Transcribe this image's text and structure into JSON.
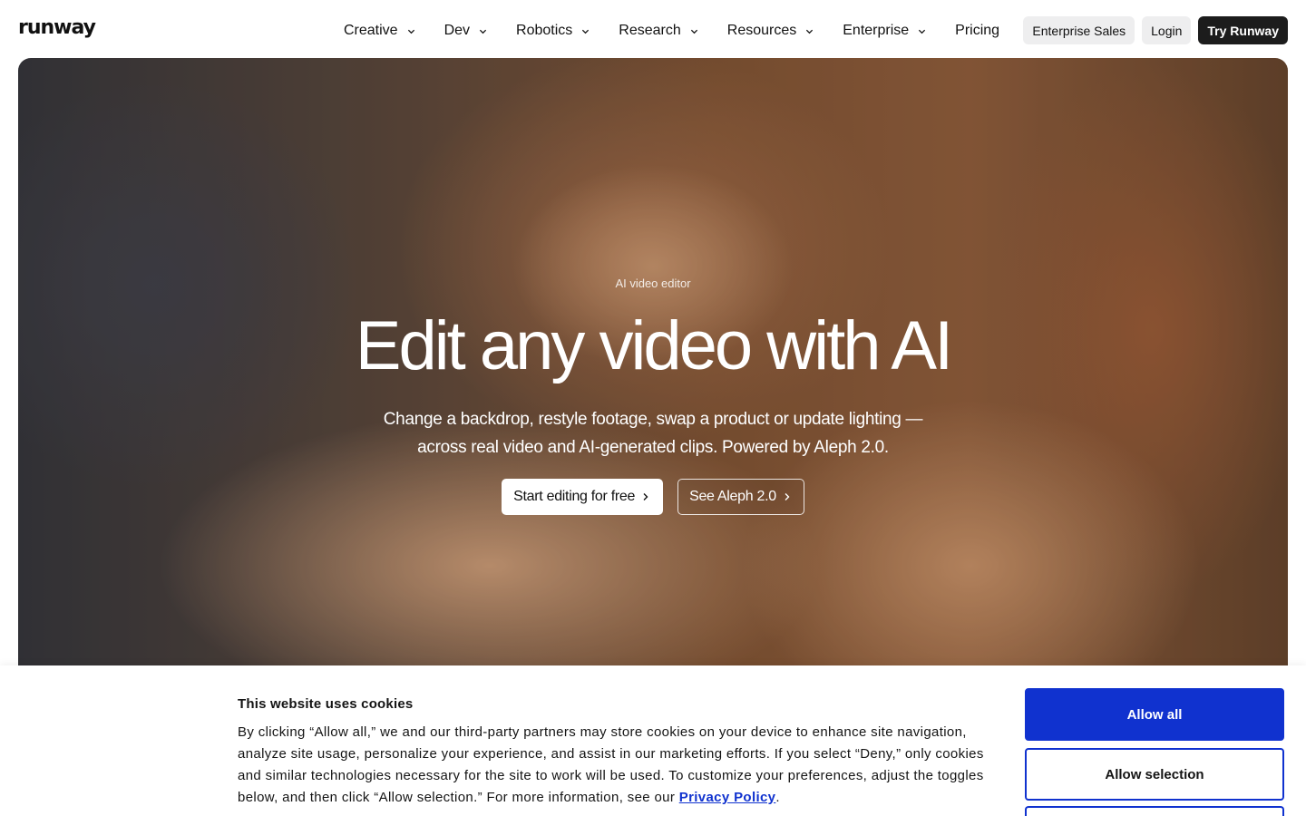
{
  "header": {
    "logo": "runway",
    "nav": [
      {
        "label": "Creative",
        "has_dropdown": true
      },
      {
        "label": "Dev",
        "has_dropdown": true
      },
      {
        "label": "Robotics",
        "has_dropdown": true
      },
      {
        "label": "Research",
        "has_dropdown": true
      },
      {
        "label": "Resources",
        "has_dropdown": true
      },
      {
        "label": "Enterprise",
        "has_dropdown": true
      },
      {
        "label": "Pricing",
        "has_dropdown": false
      }
    ],
    "actions": {
      "enterprise_sales": "Enterprise Sales",
      "login": "Login",
      "try": "Try Runway"
    }
  },
  "hero": {
    "eyebrow": "AI video editor",
    "title": "Edit any video with AI",
    "subtitle": "Change a backdrop, restyle footage, swap a product or update lighting — across real video and AI-generated clips. Powered by Aleph 2.0.",
    "cta_primary": "Start editing for free",
    "cta_secondary": "See Aleph 2.0"
  },
  "cookie_banner": {
    "title": "This website uses cookies",
    "body_before_link": "By clicking “Allow all,” we and our third-party partners may store cookies on your device to enhance site navigation, analyze site usage, personalize your experience, and assist in our marketing efforts. If you select “Deny,” only cookies and similar technologies necessary for the site to work will be used. To customize your preferences, adjust the toggles below, and then click “Allow selection.” For more information, see our ",
    "link_text": "Privacy Policy",
    "body_after_link": ".",
    "allow_all": "Allow all",
    "allow_selection": "Allow selection"
  },
  "colors": {
    "accent_blue": "#1032cf",
    "dark_button": "#1c1c1c",
    "light_button": "#eeeeef"
  }
}
